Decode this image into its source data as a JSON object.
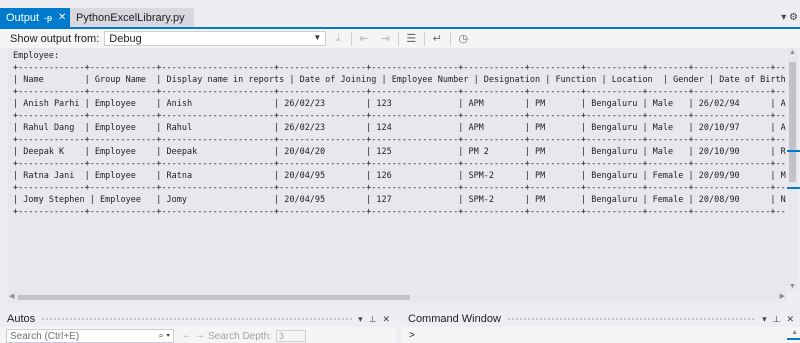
{
  "tabs": [
    {
      "label": "Output",
      "pin": "-ᵽ",
      "close": "✕"
    },
    {
      "label": "PythonExcelLibrary.py"
    }
  ],
  "tabbar_menu": "▾ ⚙",
  "toolbar": {
    "show_output_label": "Show output from:",
    "source_value": "Debug"
  },
  "output_lines": [
    "Employee:",
    "+-------------+-------------+----------------------+-----------------+-----------------+------------+----------+-----------+--------+---------------+--",
    "| Name        | Group Name  | Display name in reports | Date of Joining | Employee Number | Designation | Function | Location  | Gender | Date of Birth | F",
    "+-------------+-------------+----------------------+-----------------+-----------------+------------+----------+-----------+--------+---------------+--",
    "| Anish Parhi | Employee    | Anish                | 26/02/23        | 123             | APM        | PM       | Bengaluru | Male   | 26/02/94      | A",
    "+-------------+-------------+----------------------+-----------------+-----------------+------------+----------+-----------+--------+---------------+--",
    "| Rahul Dang  | Employee    | Rahul                | 26/02/23        | 124             | APM        | PM       | Bengaluru | Male   | 20/10/97      | A",
    "+-------------+-------------+----------------------+-----------------+-----------------+------------+----------+-----------+--------+---------------+--",
    "| Deepak K    | Employee    | Deepak               | 20/04/20        | 125             | PM 2       | PM       | Bengaluru | Male   | 20/10/90      | R",
    "+-------------+-------------+----------------------+-----------------+-----------------+------------+----------+-----------+--------+---------------+--",
    "| Ratna Jani  | Employee    | Ratna                | 20/04/95        | 126             | SPM-2      | PM       | Bengaluru | Female | 20/09/90      | M",
    "+-------------+-------------+----------------------+-----------------+-----------------+------------+----------+-----------+--------+---------------+--",
    "| Jomy Stephen | Employee   | Jomy                 | 20/04/95        | 127             | SPM-2      | PM       | Bengaluru | Female | 20/08/90      | N",
    "+-------------+-------------+----------------------+-----------------+-----------------+------------+----------+-----------+--------+---------------+--"
  ],
  "autos": {
    "title": "Autos",
    "search_placeholder": "Search (Ctrl+E)",
    "search_depth_label": "Search Depth:",
    "search_depth_value": "3"
  },
  "command_window": {
    "title": "Command Window",
    "prompt": ">"
  },
  "icons": [
    "pin-icon",
    "close-icon",
    "dropdown-arrow-icon",
    "gear-icon",
    "search-icon",
    "clear-all-icon",
    "word-wrap-icon",
    "clock-icon"
  ]
}
